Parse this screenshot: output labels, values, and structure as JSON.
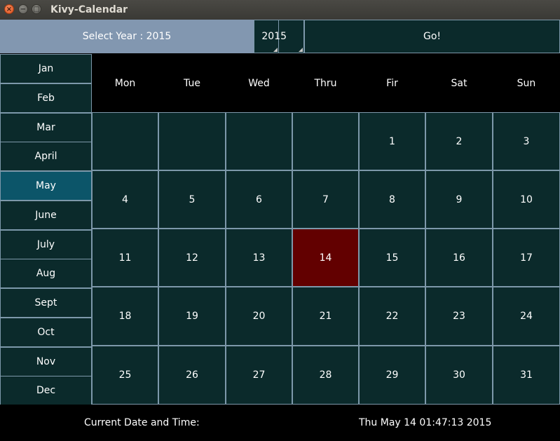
{
  "window": {
    "title": "Kivy-Calendar",
    "controls": {
      "close": "×",
      "minimize": "−",
      "maximize": "□"
    }
  },
  "year_bar": {
    "label": "Select Year : 2015",
    "spinner_value": "2015",
    "go_label": "Go!"
  },
  "months": [
    "Jan",
    "Feb",
    "Mar",
    "April",
    "May",
    "June",
    "July",
    "Aug",
    "Sept",
    "Oct",
    "Nov",
    "Dec"
  ],
  "selected_month_index": 4,
  "weekdays": [
    "Mon",
    "Tue",
    "Wed",
    "Thru",
    "Fir",
    "Sat",
    "Sun"
  ],
  "weeks": [
    [
      "",
      "",
      "",
      "",
      "1",
      "2",
      "3"
    ],
    [
      "4",
      "5",
      "6",
      "7",
      "8",
      "9",
      "10"
    ],
    [
      "11",
      "12",
      "13",
      "14",
      "15",
      "16",
      "17"
    ],
    [
      "18",
      "19",
      "20",
      "21",
      "22",
      "23",
      "24"
    ],
    [
      "25",
      "26",
      "27",
      "28",
      "29",
      "30",
      "31"
    ]
  ],
  "today": "14",
  "footer": {
    "label": "Current Date and Time:",
    "value": "Thu May 14 01:47:13 2015"
  },
  "colors": {
    "cell_bg": "#0b2a2b",
    "cell_border": "#7d98aa",
    "selected_month": "#0c5569",
    "today_bg": "#620000",
    "year_label_bg": "#8297b0"
  }
}
